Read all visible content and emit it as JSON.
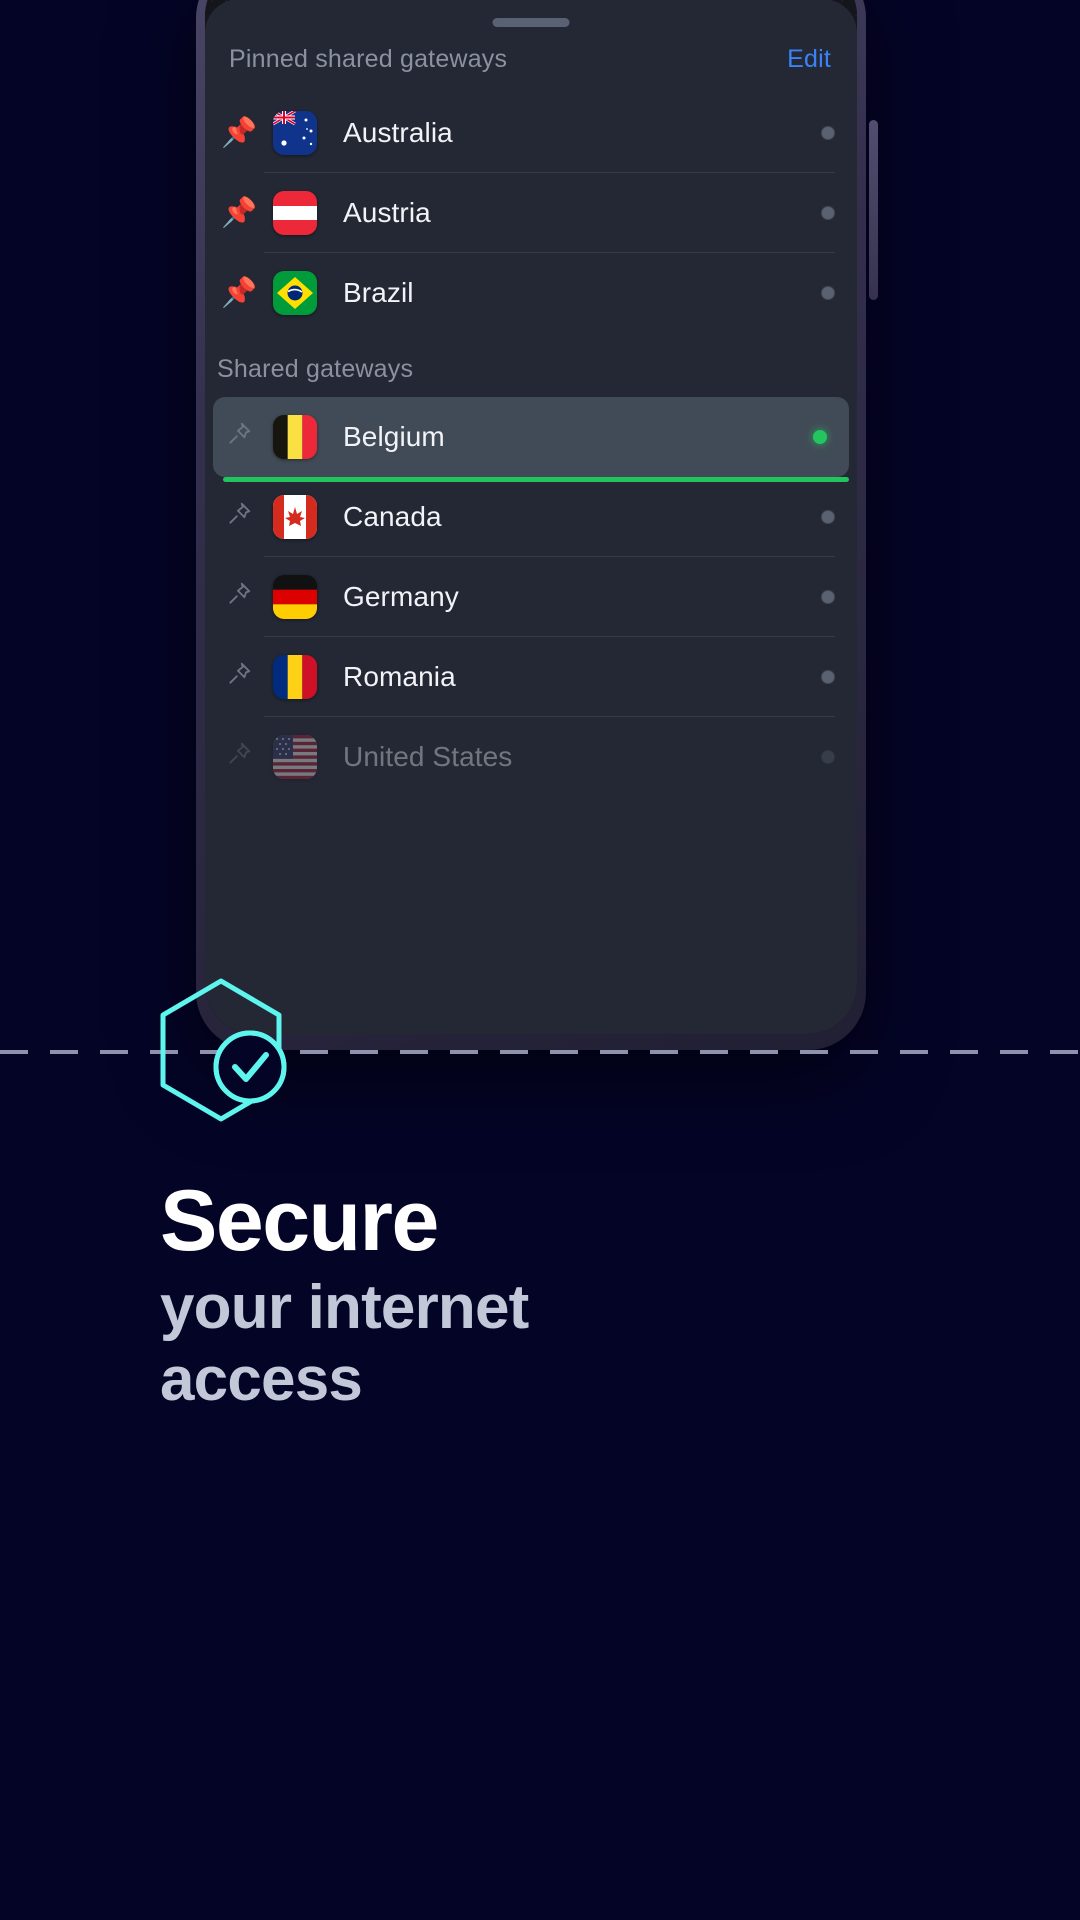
{
  "app": {
    "background_color": "#040427",
    "sheet_color": "#232834",
    "accent_green": "#22c55e",
    "accent_blue": "#3b82f6",
    "accent_cyan": "#5ef5ee"
  },
  "sheet": {
    "pinned_label": "Pinned shared gateways",
    "edit_label": "Edit",
    "shared_label": "Shared gateways",
    "pinned_gateways": [
      {
        "name": "Australia",
        "flag": "au",
        "pinned": true,
        "connected": false,
        "dimmed": false
      },
      {
        "name": "Austria",
        "flag": "at",
        "pinned": true,
        "connected": false,
        "dimmed": false
      },
      {
        "name": "Brazil",
        "flag": "br",
        "pinned": true,
        "connected": false,
        "dimmed": false
      }
    ],
    "shared_gateways": [
      {
        "name": "Belgium",
        "flag": "be",
        "pinned": false,
        "connected": true,
        "dimmed": false,
        "selected": true
      },
      {
        "name": "Canada",
        "flag": "ca",
        "pinned": false,
        "connected": false,
        "dimmed": false
      },
      {
        "name": "Germany",
        "flag": "de",
        "pinned": false,
        "connected": false,
        "dimmed": false
      },
      {
        "name": "Romania",
        "flag": "ro",
        "pinned": false,
        "connected": false,
        "dimmed": false
      },
      {
        "name": "United States",
        "flag": "us",
        "pinned": false,
        "connected": false,
        "dimmed": true
      }
    ]
  },
  "promo": {
    "headline": "Secure",
    "subhead_line1": "your internet",
    "subhead_line2": "access",
    "icon_name": "shield-check-icon"
  }
}
